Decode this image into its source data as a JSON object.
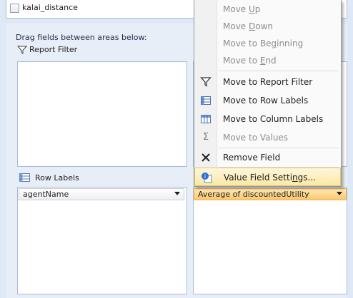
{
  "field_list": {
    "item": "kalai_distance"
  },
  "layout_panel": {
    "drag_instruction": "Drag fields between areas below:",
    "report_filter_label": "Report Filter",
    "row_labels_label": "Row Labels",
    "row_field": "agentName",
    "value_field": "Average of discountedUtility"
  },
  "context_menu": {
    "items": [
      {
        "label": "Move Up",
        "accel": "U",
        "disabled": true
      },
      {
        "label": "Move Down",
        "accel": "D",
        "disabled": true
      },
      {
        "label": "Move to Beginning",
        "accel": "g",
        "disabled": true
      },
      {
        "label": "Move to End",
        "accel": "E",
        "disabled": true
      },
      {
        "label": "Move to Report Filter",
        "disabled": false
      },
      {
        "label": "Move to Row Labels",
        "disabled": false
      },
      {
        "label": "Move to Column Labels",
        "disabled": false
      },
      {
        "label": "Move to Values",
        "disabled": true
      },
      {
        "label": "Remove Field",
        "disabled": false
      },
      {
        "label": "Value Field Settings...",
        "accel": "n",
        "disabled": false
      }
    ]
  }
}
